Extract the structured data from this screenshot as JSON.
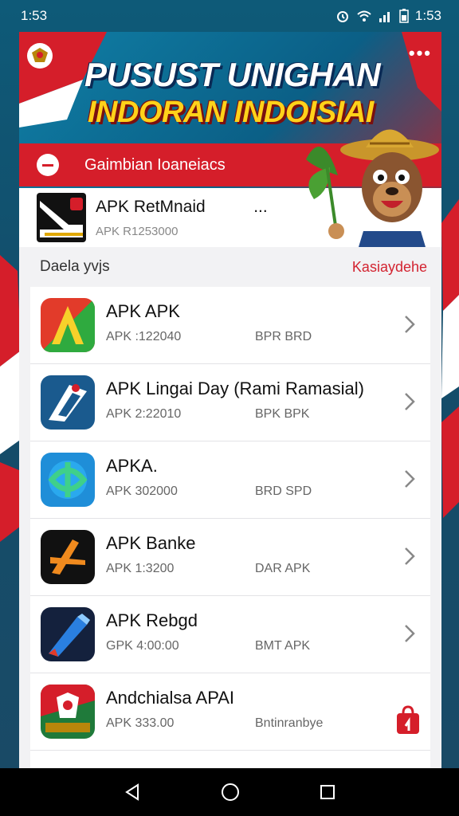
{
  "status_bar": {
    "time_left": "1:53",
    "time_right": "1:53"
  },
  "banner": {
    "title": "PUSUST UNIGHAN",
    "subtitle": "INDORAN INDOISIAI",
    "menu": "•••",
    "band_label": "Gaimbian Ioaneiacs"
  },
  "featured": {
    "title": "APK RetMnaid",
    "title_suffix": "...",
    "subtitle": "APK R1253000"
  },
  "section": {
    "title": "Daela yvjs",
    "link": "Kasiaydehe"
  },
  "apps": [
    {
      "title": "APK APK",
      "meta": "APK :122040",
      "meta2": "BPR BRD",
      "icon": "red-green-a-icon",
      "action": "chevron"
    },
    {
      "title": "APK Lingai Day (Rami Ramasial)",
      "meta": "APK 2:22010",
      "meta2": "BPK BPK",
      "icon": "blue-arrow-icon",
      "action": "chevron"
    },
    {
      "title": "APKA.",
      "meta": "APK 302000",
      "meta2": "BRD SPD",
      "icon": "blue-knot-icon",
      "action": "chevron"
    },
    {
      "title": "APK Banke",
      "meta": "APK 1:3200",
      "meta2": "DAR APK",
      "icon": "orange-x-icon",
      "action": "chevron"
    },
    {
      "title": "APK Rebgd",
      "meta": "GPK 4:00:00",
      "meta2": "BMT APK",
      "icon": "pencil-icon",
      "action": "chevron"
    },
    {
      "title": "Andchialsa APAI",
      "meta": "APK 333.00",
      "meta2": "Bntinranbye",
      "icon": "garuda-badge-icon",
      "action": "download"
    }
  ],
  "colors": {
    "accent_red": "#d51e2a",
    "banner_blue": "#0f7fa6",
    "title_yellow": "#ffd21a"
  }
}
